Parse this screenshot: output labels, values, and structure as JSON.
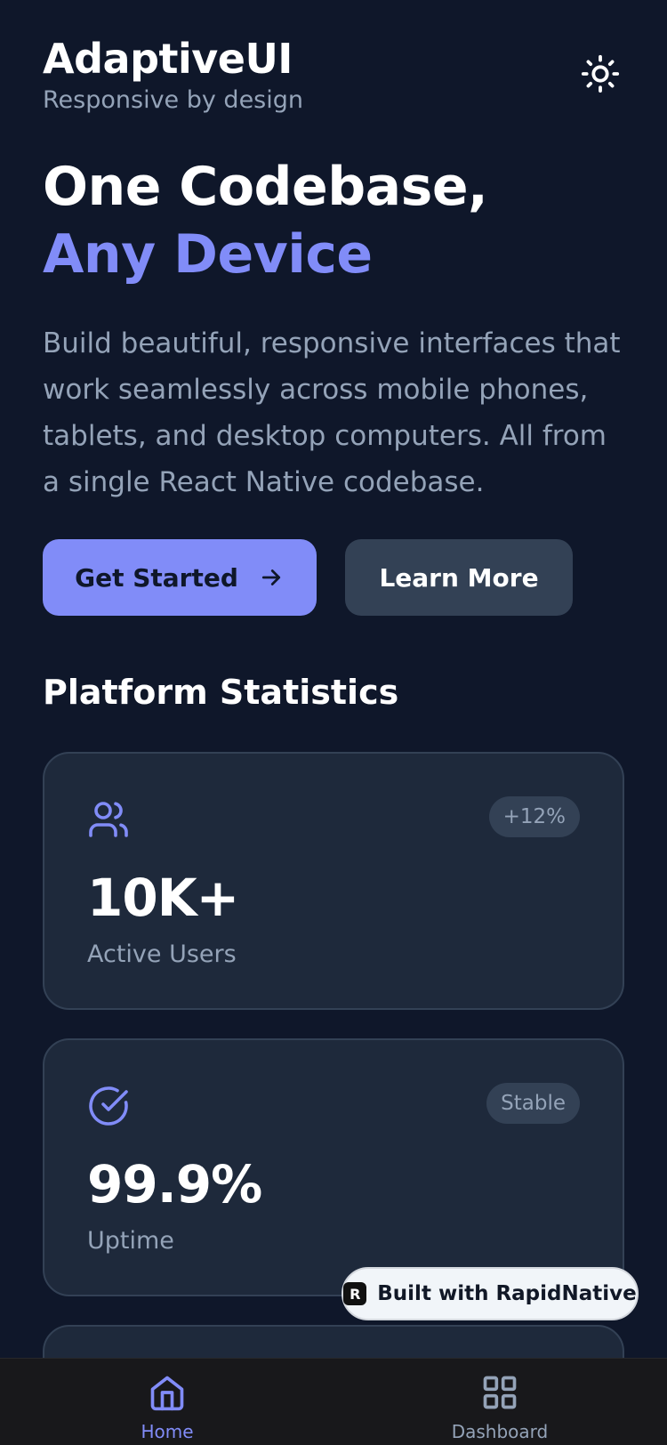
{
  "header": {
    "title": "AdaptiveUI",
    "subtitle": "Responsive by design",
    "theme_icon": "sun-icon"
  },
  "hero": {
    "line1": "One Codebase,",
    "line2": "Any Device",
    "description": "Build beautiful, responsive interfaces that work seamlessly across mobile phones, tablets, and desktop computers. All from a single React Native codebase.",
    "primary_button": "Get Started",
    "secondary_button": "Learn More"
  },
  "stats": {
    "title": "Platform Statistics",
    "cards": [
      {
        "icon": "users-icon",
        "badge": "+12%",
        "value": "10K+",
        "label": "Active Users"
      },
      {
        "icon": "check-circle-icon",
        "badge": "Stable",
        "value": "99.9%",
        "label": "Uptime"
      }
    ]
  },
  "promo_badge": {
    "label": "Built with RapidNative"
  },
  "tabbar": {
    "tabs": [
      {
        "label": "Home",
        "icon": "home-icon",
        "active": true
      },
      {
        "label": "Dashboard",
        "icon": "grid-icon",
        "active": false
      }
    ]
  },
  "colors": {
    "background": "#0f172a",
    "card": "#1e293b",
    "accent": "#818cf8",
    "muted_text": "#94a3b8"
  }
}
